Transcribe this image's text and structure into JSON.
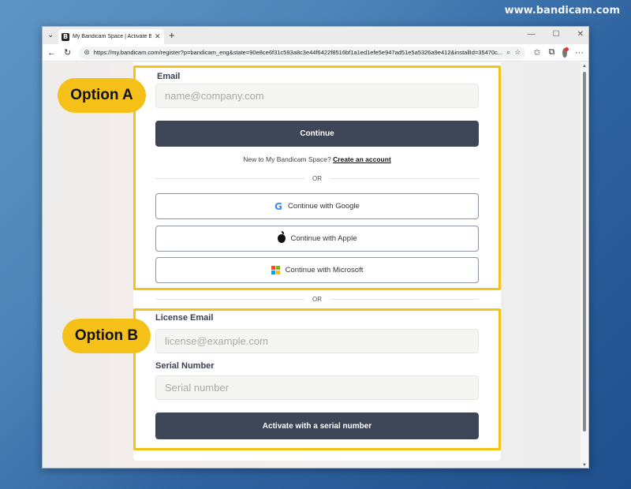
{
  "watermark": "www.bandicam.com",
  "browser": {
    "tab_title": "My Bandicam Space | Activate Bandicam",
    "favicon_letter": "B",
    "url": "https://my.bandicam.com/register?p=bandicam_eng&state=90e8ce6f31c593a8c3e44f6422f8516bf1a1ed1efe5e947ad51e5a5326a9e412&installId=35470c..."
  },
  "option_a": {
    "badge": "Option A",
    "email_label": "Email",
    "email_placeholder": "name@company.com",
    "continue_label": "Continue",
    "new_user_text": "New to My Bandicam Space?",
    "create_account_link": "Create an account",
    "or_text": "OR",
    "google_label": "Continue with Google",
    "apple_label": "Continue with Apple",
    "microsoft_label": "Continue with Microsoft"
  },
  "middle_or": "OR",
  "option_b": {
    "badge": "Option B",
    "license_email_label": "License Email",
    "license_email_placeholder": "license@example.com",
    "serial_label": "Serial Number",
    "serial_placeholder": "Serial number",
    "activate_label": "Activate with a serial number"
  },
  "colors": {
    "highlight": "#f3c417",
    "dark_button": "#3d4656",
    "badge": "#f5c118"
  }
}
